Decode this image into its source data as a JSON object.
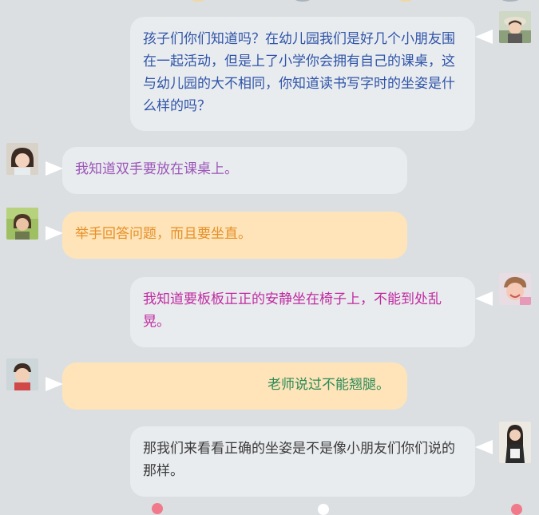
{
  "colors": {
    "background": "#dcdfe1",
    "bubble_grey": "#e9ecef",
    "bubble_peach": "#fee4b8",
    "text_blue": "#2f54a8",
    "text_purple": "#9b56b8",
    "text_orange": "#e6902a",
    "text_magenta": "#c02ba0",
    "text_green": "#2a8a58",
    "text_dark": "#3a3a3a"
  },
  "messages": [
    {
      "side": "right",
      "avatar_icon": "avatar-woman-hat-icon",
      "text": "孩子们你们知道吗？在幼儿园我们是好几个小朋友围在一起活动，但是上了小学你会拥有自己的课桌，这与幼儿园的大不相同，你知道读书写字时的坐姿是什么样的吗？"
    },
    {
      "side": "left",
      "avatar_icon": "avatar-child-girl-icon",
      "text": "我知道双手要放在课桌上。"
    },
    {
      "side": "left",
      "avatar_icon": "avatar-child-outdoor-icon",
      "text": "举手回答问题，而且要坐直。"
    },
    {
      "side": "right",
      "avatar_icon": "avatar-child-smiling-icon",
      "text": "我知道要板板正正的安静坐在椅子上，不能到处乱晃。"
    },
    {
      "side": "left",
      "avatar_icon": "avatar-child-boy-icon",
      "text": "老师说过不能翘腿。"
    },
    {
      "side": "right",
      "avatar_icon": "avatar-woman-portrait-icon",
      "text": "那我们来看看正确的坐姿是不是像小朋友们你们说的那样。"
    }
  ]
}
